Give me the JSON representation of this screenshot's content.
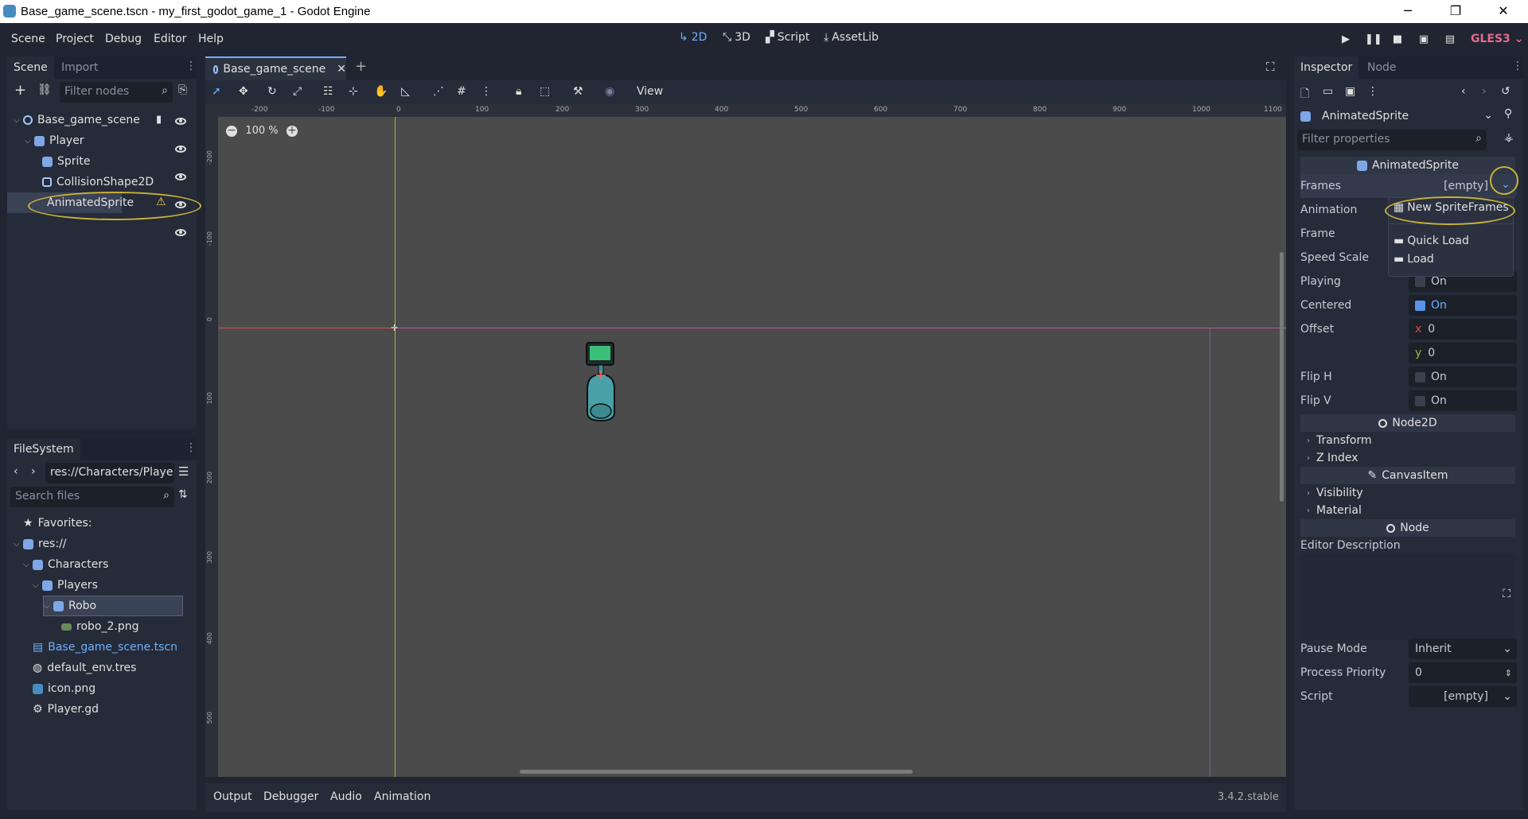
{
  "window": {
    "title": "Base_game_scene.tscn - my_first_godot_game_1 - Godot Engine",
    "minimize": "─",
    "maximize": "❐",
    "close": "✕"
  },
  "menu": [
    "Scene",
    "Project",
    "Debug",
    "Editor",
    "Help"
  ],
  "workspaces": {
    "w2d": "2D",
    "w3d": "3D",
    "script": "Script",
    "assetlib": "AssetLib"
  },
  "renderer": "GLES3",
  "scene_dock": {
    "tabs": [
      "Scene",
      "Import"
    ],
    "filter_placeholder": "Filter nodes",
    "nodes": [
      "Base_game_scene",
      "Player",
      "Sprite",
      "CollisionShape2D",
      "AnimatedSprite"
    ]
  },
  "filesystem": {
    "title": "FileSystem",
    "path": "res://Characters/Playe",
    "search_placeholder": "Search files",
    "items": [
      "Favorites:",
      "res://",
      "Characters",
      "Players",
      "Robo",
      "robo_2.png",
      "Base_game_scene.tscn",
      "default_env.tres",
      "icon.png",
      "Player.gd"
    ]
  },
  "editor": {
    "tab": "Base_game_scene",
    "zoom": "100 %",
    "view_menu": "View",
    "ruler_x": [
      "-200",
      "-100",
      "0",
      "100",
      "200",
      "300",
      "400",
      "500",
      "600",
      "700",
      "800",
      "900",
      "1000",
      "1100"
    ],
    "ruler_y": [
      "-200",
      "-100",
      "0",
      "100",
      "200",
      "300",
      "400",
      "500"
    ]
  },
  "bottom": {
    "tabs": [
      "Output",
      "Debugger",
      "Audio",
      "Animation"
    ],
    "version": "3.4.2.stable"
  },
  "inspector": {
    "tabs": [
      "Inspector",
      "Node"
    ],
    "object": "AnimatedSprite",
    "filter_placeholder": "Filter properties",
    "section_animated": "AnimatedSprite",
    "frames_label": "Frames",
    "frames_value": "[empty]",
    "animation_label": "Animation",
    "frame_label": "Frame",
    "speed_label": "Speed Scale",
    "playing_label": "Playing",
    "centered_label": "Centered",
    "offset_label": "Offset",
    "offset_x_axis": "x",
    "offset_x": "0",
    "offset_y_axis": "y",
    "offset_y": "0",
    "fliph_label": "Flip H",
    "flipv_label": "Flip V",
    "on": "On",
    "section_node2d": "Node2D",
    "transform": "Transform",
    "zindex": "Z Index",
    "section_canvas": "CanvasItem",
    "visibility": "Visibility",
    "material": "Material",
    "section_node": "Node",
    "editor_desc": "Editor Description",
    "pause_label": "Pause Mode",
    "pause_value": "Inherit",
    "priority_label": "Process Priority",
    "priority_value": "0",
    "script_label": "Script",
    "script_value": "[empty]"
  },
  "dropdown": {
    "new": "New SpriteFrames",
    "quick": "Quick Load",
    "load": "Load"
  },
  "colors": {
    "accent": "#6fb0ff",
    "highlight": "#c8b23a",
    "x_axis": "#d84a4a",
    "y_axis": "#8fbf4a"
  }
}
